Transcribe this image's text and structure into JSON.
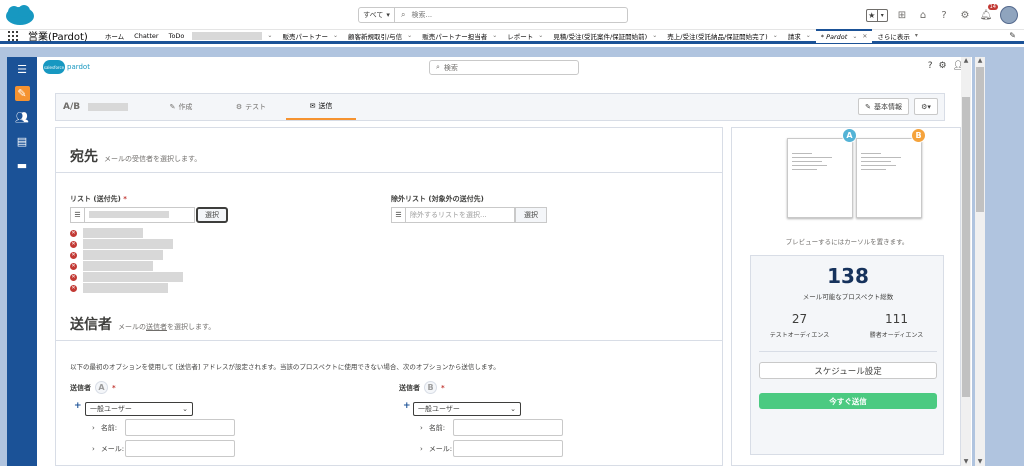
{
  "header": {
    "search_scope": "すべて",
    "search_placeholder": "検索...",
    "notification_count": "14"
  },
  "nav": {
    "app_name": "営業(Pardot)",
    "items": [
      {
        "label": "ホーム",
        "chevron": false
      },
      {
        "label": "Chatter",
        "chevron": false
      },
      {
        "label": "ToDo",
        "chevron": true
      },
      {
        "label": "",
        "chevron": true,
        "blurred": true
      },
      {
        "label": "販売パートナー",
        "chevron": true
      },
      {
        "label": "顧客新規取引/与信",
        "chevron": true
      },
      {
        "label": "販売パートナー担当者",
        "chevron": true
      },
      {
        "label": "レポート",
        "chevron": true
      },
      {
        "label": "見積/受注(受託案件/保証開始前)",
        "chevron": true
      },
      {
        "label": "売上/受注(受託納品/保証開始完了)",
        "chevron": true
      },
      {
        "label": "請求",
        "chevron": true
      }
    ],
    "active_tab": "* Pardot",
    "more": "さらに表示"
  },
  "pardot": {
    "logo_cloud": "salesforce",
    "logo_text": "pardot",
    "search_placeholder": "検索"
  },
  "ab": {
    "title": "A/B",
    "steps": [
      {
        "icon": "✎",
        "label": "作成"
      },
      {
        "icon": "⚙",
        "label": "テスト"
      },
      {
        "icon": "✉",
        "label": "送信"
      }
    ],
    "basic_info": "基本情報"
  },
  "recipients": {
    "title": "宛先",
    "subtitle": "メールの受信者を選択します。",
    "list_label": "リスト (送付先)",
    "required": "*",
    "select_btn": "選択",
    "exclude_label": "除外リスト (対象外の送付先)",
    "exclude_placeholder": "除外するリストを選択...",
    "exclude_btn": "選択"
  },
  "sender": {
    "title": "送信者",
    "subtitle_pre": "メールの",
    "subtitle_link": "送信者",
    "subtitle_post": "を選択します。",
    "note": "以下の最初のオプションを使用して [送信者] アドレスが設定されます。当該のプロスペクトに使用できない場合、次のオプションから送信します。",
    "a_label": "送信者",
    "a_letter": "A",
    "b_label": "送信者",
    "b_letter": "B",
    "required": "*",
    "select_value": "一般ユーザー",
    "name_label": "名前:",
    "mail_label": "メール:"
  },
  "preview": {
    "badge_a": "A",
    "badge_b": "B",
    "hint": "プレビューするにはカーソルを置きます。",
    "total": "138",
    "total_label": "メール可能なプロスペクト総数",
    "test_count": "27",
    "test_label": "テストオーディエンス",
    "winner_count": "111",
    "winner_label": "勝者オーディエンス",
    "schedule": "スケジュール設定",
    "send_now": "今すぐ送信"
  },
  "colors": {
    "brand_blue": "#1b5297",
    "accent_orange": "#f59331",
    "badge_a": "#54b3d6",
    "badge_b": "#f5a33c",
    "send_green": "#4bca81"
  }
}
